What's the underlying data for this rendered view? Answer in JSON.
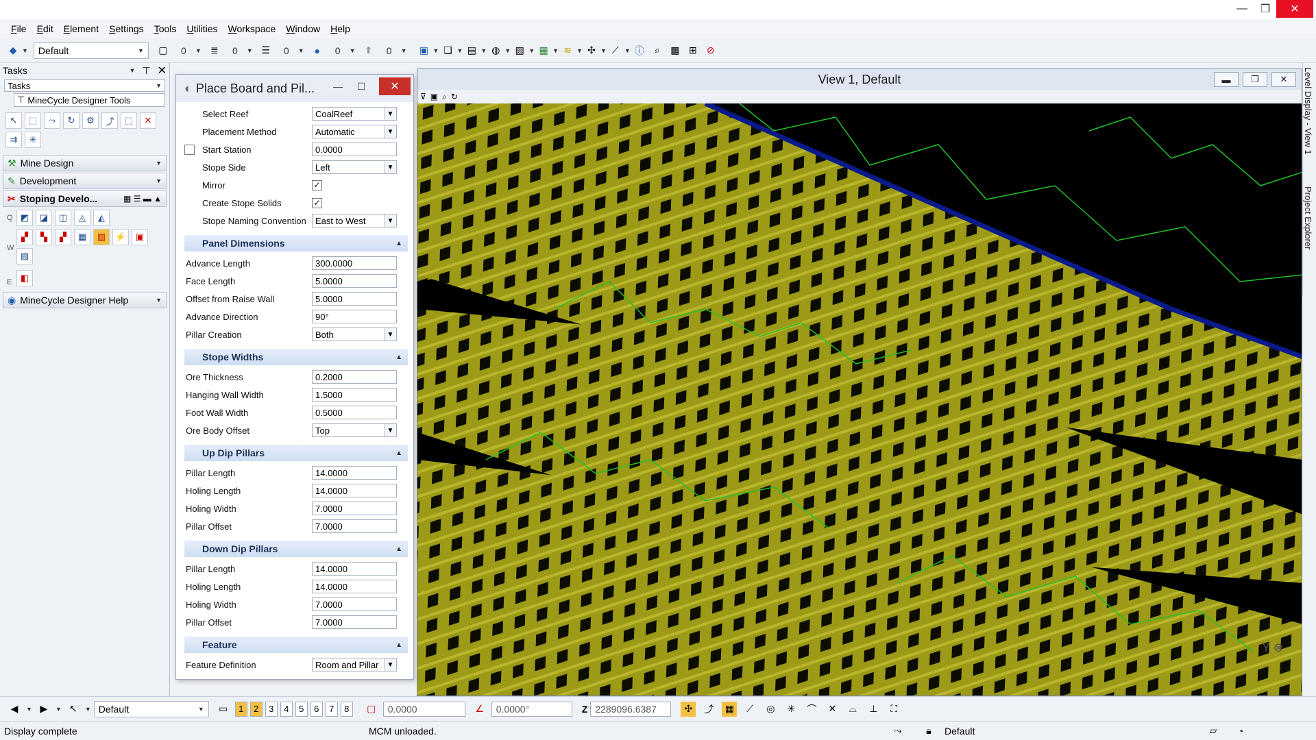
{
  "window": {
    "minimize": "—",
    "maximize": "❐",
    "close": "✕"
  },
  "menu": [
    "File",
    "Edit",
    "Element",
    "Settings",
    "Tools",
    "Utilities",
    "Workspace",
    "Window",
    "Help"
  ],
  "toolbar": {
    "combo": "Default",
    "counts": [
      "0",
      "0",
      "0",
      "0",
      "0"
    ]
  },
  "tasks": {
    "title": "Tasks",
    "dropdown": "Tasks",
    "tree_label": "MineCycle Designer Tools",
    "groups": [
      "Mine Design",
      "Development"
    ],
    "stoping_label": "Stoping  Develo...",
    "side_letters": [
      "Q",
      "W",
      "E"
    ],
    "help_group": "MineCycle Designer Help"
  },
  "dialog": {
    "title": "Place Board and Pil...",
    "top_fields": [
      {
        "label": "Select Reef",
        "value": "CoalReef",
        "type": "dropdown"
      },
      {
        "label": "Placement Method",
        "value": "Automatic",
        "type": "dropdown"
      },
      {
        "label": "Start Station",
        "value": "0.0000",
        "type": "text",
        "checkbox": true
      },
      {
        "label": "Stope Side",
        "value": "Left",
        "type": "dropdown"
      },
      {
        "label": "Mirror",
        "value": "✓",
        "type": "check"
      },
      {
        "label": "Create Stope Solids",
        "value": "✓",
        "type": "check"
      },
      {
        "label": "Stope Naming Convention",
        "value": "East to West",
        "type": "dropdown"
      }
    ],
    "sections": [
      {
        "title": "Panel Dimensions",
        "fields": [
          {
            "label": "Advance Length",
            "value": "300.0000",
            "type": "text"
          },
          {
            "label": "Face Length",
            "value": "5.0000",
            "type": "text"
          },
          {
            "label": "Offset from Raise Wall",
            "value": "5.0000",
            "type": "text"
          },
          {
            "label": "Advance Direction",
            "value": "90°",
            "type": "text"
          },
          {
            "label": "Pillar Creation",
            "value": "Both",
            "type": "dropdown"
          }
        ]
      },
      {
        "title": "Stope Widths",
        "fields": [
          {
            "label": "Ore Thickness",
            "value": "0.2000",
            "type": "text"
          },
          {
            "label": "Hanging Wall Width",
            "value": "1.5000",
            "type": "text"
          },
          {
            "label": "Foot Wall Width",
            "value": "0.5000",
            "type": "text"
          },
          {
            "label": "Ore Body Offset",
            "value": "Top",
            "type": "dropdown"
          }
        ]
      },
      {
        "title": "Up Dip Pillars",
        "fields": [
          {
            "label": "Pillar Length",
            "value": "14.0000",
            "type": "text"
          },
          {
            "label": "Holing Length",
            "value": "14.0000",
            "type": "text"
          },
          {
            "label": "Holing Width",
            "value": "7.0000",
            "type": "text"
          },
          {
            "label": "Pillar Offset",
            "value": "7.0000",
            "type": "text"
          }
        ]
      },
      {
        "title": "Down Dip Pillars",
        "fields": [
          {
            "label": "Pillar Length",
            "value": "14.0000",
            "type": "text"
          },
          {
            "label": "Holing Length",
            "value": "14.0000",
            "type": "text"
          },
          {
            "label": "Holing Width",
            "value": "7.0000",
            "type": "text"
          },
          {
            "label": "Pillar Offset",
            "value": "7.0000",
            "type": "text"
          }
        ]
      },
      {
        "title": "Feature",
        "fields": [
          {
            "label": "Feature Definition",
            "value": "Room and Pillar",
            "type": "dropdown"
          }
        ]
      }
    ]
  },
  "view": {
    "title": "View 1, Default",
    "background": "#000000",
    "pillar_color": "#9c9a16",
    "line_color": "#22c22a",
    "edge_color": "#0a1a8a"
  },
  "rail": {
    "level_display": "Level Display - View 1",
    "project_explorer": "Project Explorer"
  },
  "bottom": {
    "combo": "Default",
    "views": [
      "1",
      "2",
      "3",
      "4",
      "5",
      "6",
      "7",
      "8"
    ],
    "active_views": [
      "1",
      "2"
    ],
    "x": "0.0000",
    "angle": "0.0000°",
    "z_label": "Z",
    "z": "2289096.6387"
  },
  "status": {
    "left": "Display complete",
    "middle": "MCM unloaded.",
    "right": "Default"
  },
  "colors": {
    "accent": "#f4c043",
    "section": "#cfddf3",
    "close": "#e81123"
  }
}
